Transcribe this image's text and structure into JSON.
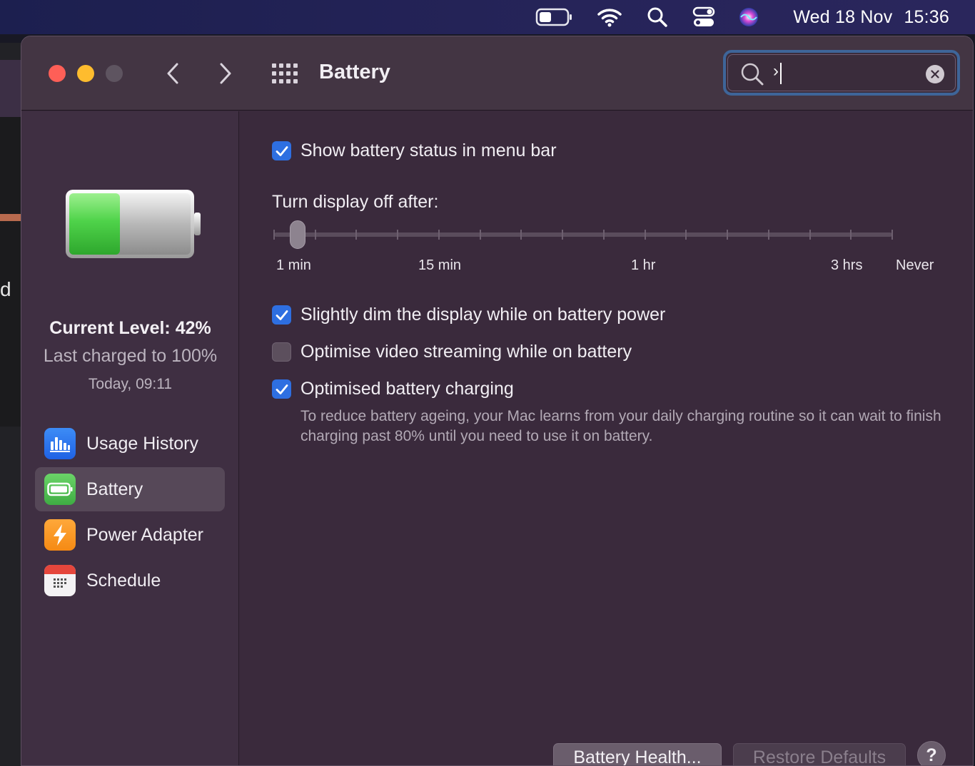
{
  "menubar": {
    "date": "Wed 18 Nov",
    "time": "15:36",
    "icons": [
      "battery-icon",
      "wifi-icon",
      "spotlight-icon",
      "control-center-icon",
      "siri-icon"
    ]
  },
  "background_app": {
    "partial_text": "d"
  },
  "window": {
    "title": "Battery",
    "search": {
      "value": "›",
      "placeholder": ""
    }
  },
  "sidebar": {
    "current_level": "Current Level: 42%",
    "last_charged": "Last charged to 100%",
    "last_charged_time": "Today, 09:11",
    "battery_level": 0.42,
    "items": [
      {
        "label": "Usage History",
        "icon": "usage-history-icon",
        "selected": false
      },
      {
        "label": "Battery",
        "icon": "battery-icon",
        "selected": true
      },
      {
        "label": "Power Adapter",
        "icon": "power-adapter-icon",
        "selected": false
      },
      {
        "label": "Schedule",
        "icon": "schedule-icon",
        "selected": false
      }
    ]
  },
  "main": {
    "show_status": {
      "label": "Show battery status in menu bar",
      "checked": true
    },
    "display_off_label": "Turn display off after:",
    "slider": {
      "tick_count": 16,
      "value_index": 0,
      "labels": [
        "1 min",
        "15 min",
        "1 hr",
        "3 hrs",
        "Never"
      ]
    },
    "dim_display": {
      "label": "Slightly dim the display while on battery power",
      "checked": true
    },
    "optimise_video": {
      "label": "Optimise video streaming while on battery",
      "checked": false
    },
    "optimised_charging": {
      "label": "Optimised battery charging",
      "checked": true
    },
    "charging_description": "To reduce battery ageing, your Mac learns from your daily charging routine so it can wait to finish charging past 80% until you need to use it on battery."
  },
  "footer": {
    "battery_health_label": "Battery Health...",
    "restore_defaults_label": "Restore Defaults",
    "help_label": "?"
  },
  "colors": {
    "accent": "#2e6fe1",
    "window_bg": "#3a2a3c",
    "sidebar_bg": "#3f2f42",
    "battery_green": "#4fd34a"
  }
}
